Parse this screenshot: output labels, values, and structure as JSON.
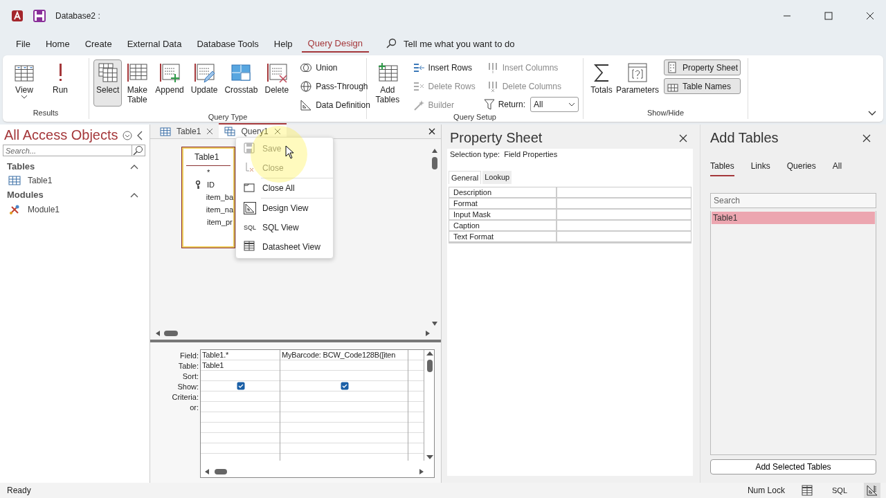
{
  "window": {
    "title": "Database2 :"
  },
  "menu_tabs": [
    {
      "label": "File",
      "selected": false
    },
    {
      "label": "Home",
      "selected": false
    },
    {
      "label": "Create",
      "selected": false
    },
    {
      "label": "External Data",
      "selected": false
    },
    {
      "label": "Database Tools",
      "selected": false
    },
    {
      "label": "Help",
      "selected": false
    },
    {
      "label": "Query Design",
      "selected": true
    }
  ],
  "tell_me": {
    "placeholder": "Tell me what you want to do"
  },
  "ribbon": {
    "groups": [
      {
        "label": "Results",
        "items": [
          {
            "kind": "large",
            "label": "View",
            "dropdown": true,
            "selected": false,
            "disabled": false
          },
          {
            "kind": "large",
            "label": "Run",
            "selected": false,
            "disabled": false
          }
        ]
      },
      {
        "label": "Query Type",
        "items": [
          {
            "kind": "large",
            "label": "Select",
            "selected": true,
            "disabled": false
          },
          {
            "kind": "large",
            "label": "Make Table",
            "selected": false,
            "disabled": false
          },
          {
            "kind": "large",
            "label": "Append",
            "selected": false,
            "disabled": false
          },
          {
            "kind": "large",
            "label": "Update",
            "selected": false,
            "disabled": false
          },
          {
            "kind": "large",
            "label": "Crosstab",
            "selected": false,
            "disabled": false
          },
          {
            "kind": "large",
            "label": "Delete",
            "selected": false,
            "disabled": false
          },
          {
            "kind": "small",
            "label": "Union",
            "selected": false,
            "disabled": false
          },
          {
            "kind": "small",
            "label": "Pass-Through",
            "selected": false,
            "disabled": false
          },
          {
            "kind": "small",
            "label": "Data Definition",
            "selected": false,
            "disabled": false
          }
        ]
      },
      {
        "label": "Query Setup",
        "items": [
          {
            "kind": "large",
            "label": "Add Tables",
            "selected": false,
            "disabled": false
          },
          {
            "kind": "small",
            "label": "Insert Rows",
            "selected": false,
            "disabled": false
          },
          {
            "kind": "small",
            "label": "Delete Rows",
            "selected": false,
            "disabled": true
          },
          {
            "kind": "small",
            "label": "Builder",
            "selected": false,
            "disabled": true
          },
          {
            "kind": "small",
            "label": "Insert Columns",
            "selected": false,
            "disabled": true
          },
          {
            "kind": "small",
            "label": "Delete Columns",
            "selected": false,
            "disabled": true
          },
          {
            "kind": "select",
            "label": "Return:",
            "value": "All"
          }
        ]
      },
      {
        "label": "Show/Hide",
        "items": [
          {
            "kind": "large",
            "label": "Totals",
            "selected": false,
            "disabled": false
          },
          {
            "kind": "large",
            "label": "Parameters",
            "selected": false,
            "disabled": false
          },
          {
            "kind": "small",
            "label": "Property Sheet",
            "selected": true,
            "disabled": false
          },
          {
            "kind": "small",
            "label": "Table Names",
            "selected": true,
            "disabled": false
          }
        ]
      }
    ]
  },
  "nav_pane": {
    "title": "All Access Objects",
    "search": {
      "placeholder": "Search..."
    },
    "sections": [
      {
        "label": "Tables",
        "expanded": true,
        "items": [
          {
            "label": "Table1"
          }
        ]
      },
      {
        "label": "Modules",
        "expanded": true,
        "items": [
          {
            "label": "Module1"
          }
        ]
      }
    ]
  },
  "document_tabs": [
    {
      "label": "Table1",
      "selected": false
    },
    {
      "label": "Query1",
      "selected": true
    }
  ],
  "query_design": {
    "table_box": {
      "title": "Table1",
      "fields": [
        {
          "name": "*",
          "primary_key": false
        },
        {
          "name": "ID",
          "primary_key": true
        },
        {
          "name": "item_ba",
          "primary_key": false
        },
        {
          "name": "item_na",
          "primary_key": false
        },
        {
          "name": "item_pr",
          "primary_key": false
        }
      ]
    },
    "grid": {
      "row_labels": [
        "Field:",
        "Table:",
        "Sort:",
        "Show:",
        "Criteria:",
        "or:"
      ],
      "columns": [
        {
          "field": "Table1.*",
          "table": "Table1",
          "show": true
        },
        {
          "field": "MyBarcode: BCW_Code128B([iten",
          "show": true
        }
      ]
    }
  },
  "context_menu": [
    {
      "label": "Save",
      "disabled": true,
      "separator_after": false
    },
    {
      "label": "Close",
      "disabled": true,
      "separator_after": true
    },
    {
      "label": "Close All",
      "disabled": false,
      "separator_after": true
    },
    {
      "label": "Design View",
      "disabled": false,
      "separator_after": false
    },
    {
      "label": "SQL View",
      "icon_text": "SQL",
      "disabled": false,
      "separator_after": false
    },
    {
      "label": "Datasheet View",
      "disabled": false,
      "separator_after": false
    }
  ],
  "property_sheet": {
    "title": "Property Sheet",
    "selection_label": "Selection type:",
    "selection_value": "Field Properties",
    "tabs": [
      {
        "label": "General",
        "selected": true
      },
      {
        "label": "Lookup",
        "selected": false
      }
    ],
    "properties": [
      {
        "name": "Description"
      },
      {
        "name": "Format"
      },
      {
        "name": "Input Mask"
      },
      {
        "name": "Caption"
      },
      {
        "name": "Text Format"
      }
    ]
  },
  "add_tables": {
    "title": "Add Tables",
    "tabs": [
      {
        "label": "Tables",
        "selected": true
      },
      {
        "label": "Links",
        "selected": false
      },
      {
        "label": "Queries",
        "selected": false
      },
      {
        "label": "All",
        "selected": false
      }
    ],
    "search": {
      "placeholder": "Search"
    },
    "items": [
      {
        "label": "Table1",
        "selected": true
      }
    ],
    "button": "Add Selected Tables"
  },
  "status_bar": {
    "text": "Ready",
    "num_lock": "Num Lock",
    "views": [
      {
        "kind": "datasheet",
        "selected": false
      },
      {
        "kind": "sql",
        "label": "SQL",
        "selected": false
      },
      {
        "kind": "design",
        "selected": true
      }
    ]
  }
}
